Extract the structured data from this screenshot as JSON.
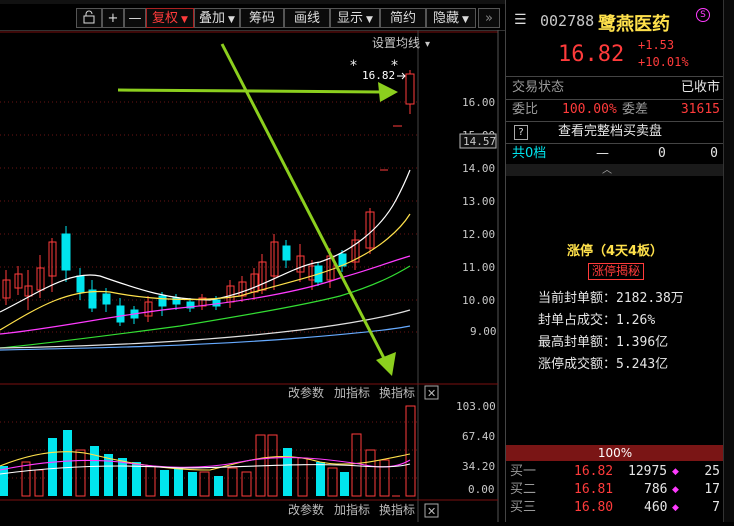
{
  "toolbar": {
    "buttons": [
      {
        "label": "",
        "icon": "lock-icon"
      },
      {
        "label": "+",
        "icon": "zoom-in-icon"
      },
      {
        "label": "—",
        "icon": "zoom-out-icon"
      },
      {
        "label": "复权",
        "dropdown": true,
        "active": true
      },
      {
        "label": "叠加",
        "dropdown": true
      },
      {
        "label": "筹码"
      },
      {
        "label": "画线"
      },
      {
        "label": "显示",
        "dropdown": true
      },
      {
        "label": "简约"
      },
      {
        "label": "隐藏",
        "dropdown": true
      }
    ]
  },
  "main_chart": {
    "ma_settings_label": "设置均线",
    "ma_settings_arrow": "▾",
    "high_marker": "16.82",
    "current_price_tag": "14.57",
    "y_ticks": [
      "16.00",
      "15.00",
      "14.00",
      "13.00",
      "12.00",
      "11.00",
      "10.00",
      "9.00"
    ],
    "star_marks": [
      "*",
      "*"
    ]
  },
  "indicator_bar_top": {
    "params": "改参数",
    "add": "加指标",
    "swap": "换指标",
    "close": "✕"
  },
  "indicator_bar_bottom": {
    "params": "改参数",
    "add": "加指标",
    "swap": "换指标",
    "close": "✕"
  },
  "volume_chart": {
    "y_ticks": [
      "103.00",
      "67.40",
      "34.20",
      "0.00"
    ]
  },
  "panel": {
    "code": "002788",
    "name": "鹭燕医药",
    "price": "16.82",
    "change": "+1.53",
    "change_pct": "+10.01%",
    "trade_status_label": "交易状态",
    "trade_status_value": "已收市",
    "weibi_label": "委比",
    "weibi_value": "100.00%",
    "weicha_label": "委差",
    "weicha_value": "31615",
    "full_book_label": "查看完整档买卖盘",
    "full_book_prefix": "?",
    "gongdang_label": "共0档",
    "gongdang_dash": "—",
    "gongdang_v1": "0",
    "gongdang_v2": "0",
    "limit_title": "涨停（4天4板）",
    "limit_tag": "涨停揭秘",
    "stats": [
      {
        "label": "当前封单额：",
        "value": "2182.38万"
      },
      {
        "label": "封单占成交：",
        "value": "1.26%"
      },
      {
        "label": "最高封单额：",
        "value": "1.396亿"
      },
      {
        "label": "涨停成交额：",
        "value": "5.243亿"
      }
    ],
    "bid_pct": "100%",
    "bids": [
      {
        "label": "买一",
        "price": "16.82",
        "vol": "12975",
        "count": "25"
      },
      {
        "label": "买二",
        "price": "16.81",
        "vol": "786",
        "count": "17"
      },
      {
        "label": "买三",
        "price": "16.80",
        "vol": "460",
        "count": "7"
      }
    ],
    "colors": {
      "up": "#ff3b3b",
      "name": "#ffe14b",
      "cyan": "#00e5ee"
    }
  }
}
